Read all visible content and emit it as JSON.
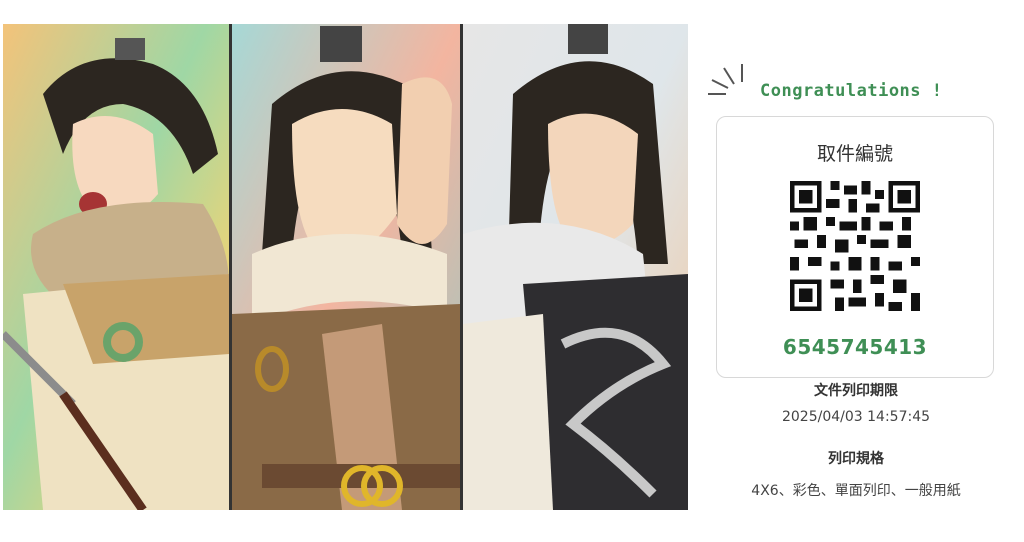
{
  "artwork": {
    "panels": [
      {
        "subject": "warrior-shouting"
      },
      {
        "subject": "warrior-pointing"
      },
      {
        "subject": "warrior-profile"
      }
    ]
  },
  "ticket": {
    "congrats_text": "Congratulations !",
    "pickup_title": "取件編號",
    "pickup_number": "6545745413",
    "deadline_label": "文件列印期限",
    "deadline_value": "2025/04/03 14:57:45",
    "spec_label": "列印規格",
    "spec_value": "4X6、彩色、單面列印、一般用紙"
  },
  "colors": {
    "accent_green": "#3f8f55",
    "text_dark": "#333333",
    "card_border": "#d8d8d8"
  }
}
